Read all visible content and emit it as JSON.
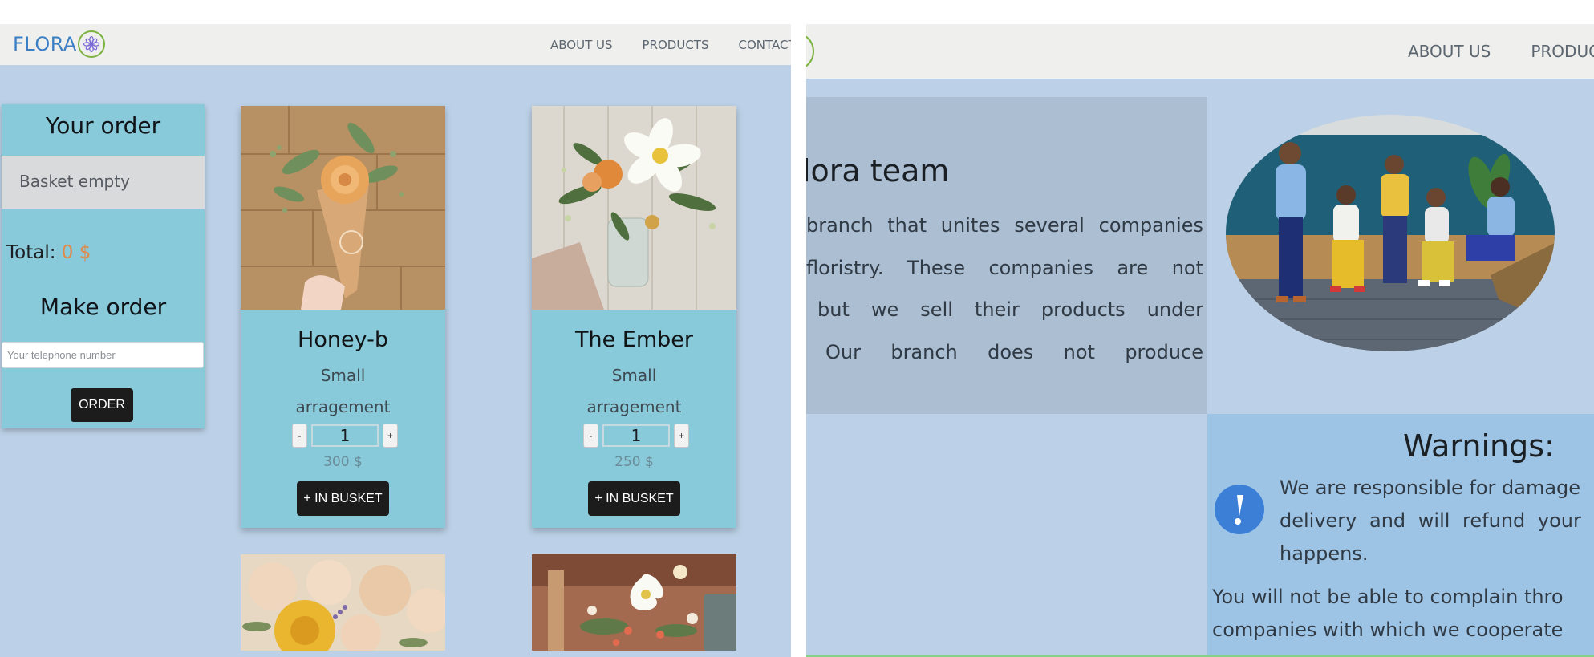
{
  "left": {
    "navbar": {
      "logo_text": "FLORA",
      "links": [
        "ABOUT US",
        "PRODUCTS",
        "CONTACT"
      ]
    },
    "order": {
      "title": "Your order",
      "basket_text": "Basket empty",
      "total_label": "Total:",
      "total_value": "0 $",
      "make_order_title": "Make order",
      "phone_placeholder": "Your telephone number",
      "order_button": "ORDER"
    },
    "products": [
      {
        "name": "Honey-b",
        "size": "Small",
        "description": "arragement",
        "quantity": "1",
        "price": "300 $",
        "button": "+ IN BUSKET",
        "minus": "-",
        "plus": "+"
      },
      {
        "name": "The Ember",
        "size": "Small",
        "description": "arragement",
        "quantity": "1",
        "price": "250 $",
        "button": "+ IN BUSKET",
        "minus": "-",
        "plus": "+"
      }
    ]
  },
  "right": {
    "navbar": {
      "links": [
        "ABOUT US",
        "PRODUC"
      ]
    },
    "team": {
      "title": "lora team",
      "lines": [
        "branch that unites several companies",
        "floristry. These companies are not",
        "but we sell their products under",
        "Our branch does not produce"
      ]
    },
    "warnings": {
      "title": "Warnings:",
      "icon": "exclamation-icon",
      "lines": [
        "We are responsible for damage",
        "delivery and will refund your",
        "happens.",
        "You will not be able to complain thro",
        "companies with which we cooperate"
      ]
    }
  },
  "colors": {
    "page_bg": "#bcd1e7",
    "nav_bg": "#efefed",
    "card_bg": "#88cad9",
    "logo_blue": "#3a7fc3",
    "logo_green": "#7cb342",
    "total_orange": "#e08a4a",
    "button_dark": "#1c1c1c",
    "team_bg": "#acbed2",
    "warn_bg": "#9ec4e5",
    "warn_icon": "#3b7fd6"
  }
}
